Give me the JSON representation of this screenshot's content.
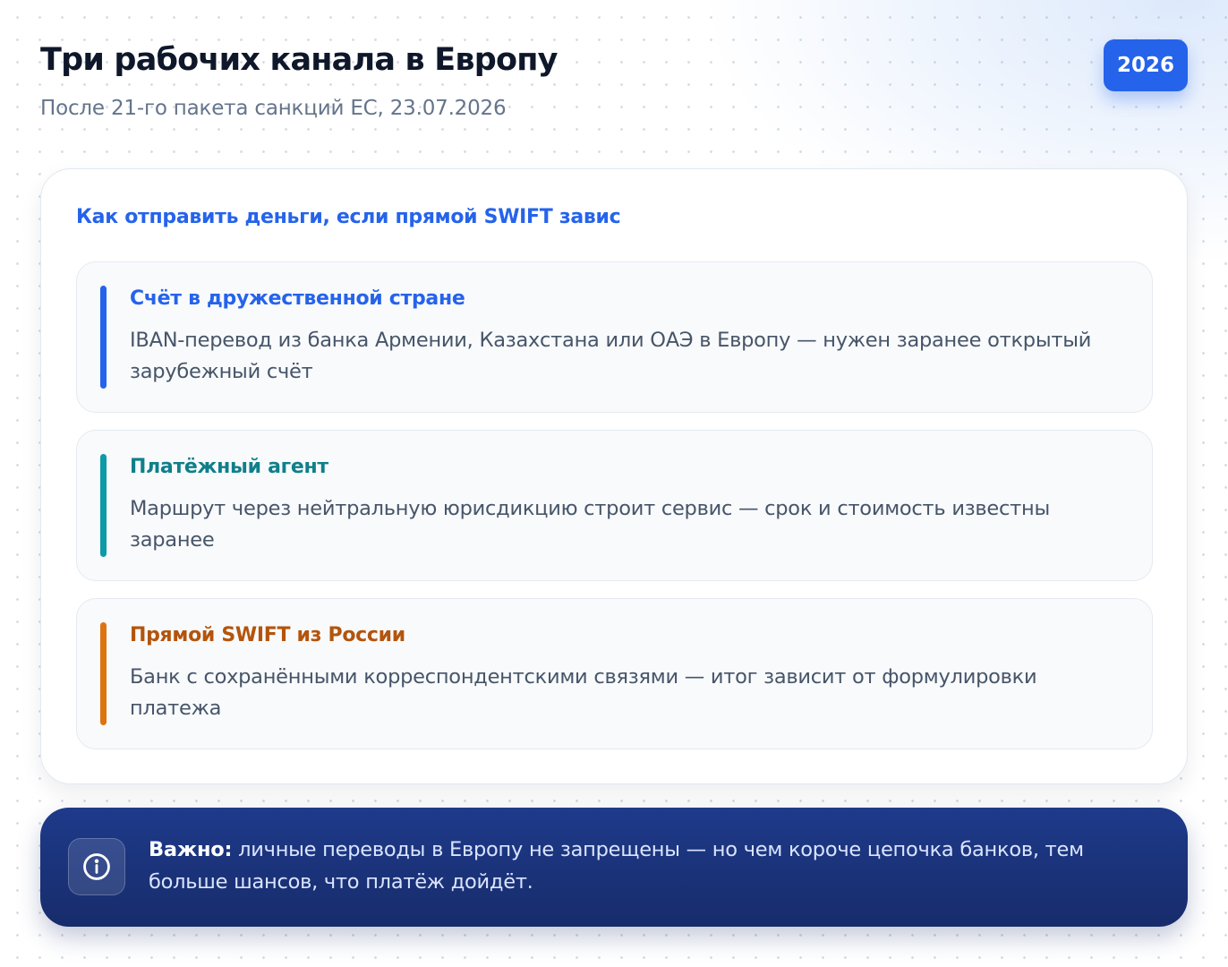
{
  "header": {
    "title": "Три рабочих канала в Европу",
    "subtitle": "После 21-го пакета санкций ЕС, 23.07.2026",
    "year_badge": "2026"
  },
  "card": {
    "heading": "Как отправить деньги, если прямой SWIFT завис",
    "channels": [
      {
        "title": "Счёт в дружественной стране",
        "description": "IBAN-перевод из банка Армении, Казахстана или ОАЭ в Европу — нужен заранее открытый зарубежный счёт",
        "accent_color": "#2563eb"
      },
      {
        "title": "Платёжный агент",
        "description": "Маршрут через нейтральную юрисдикцию строит сервис — срок и стоимость известны заранее",
        "accent_color": "#0e9aa7"
      },
      {
        "title": "Прямой SWIFT из России",
        "description": "Банк с сохранёнными корреспондентскими связями — итог зависит от формулировки платежа",
        "accent_color": "#dd7410"
      }
    ]
  },
  "notice": {
    "icon": "info-icon",
    "label": "Важно:",
    "text": "личные переводы в Европу не запрещены — но чем короче цепочка банков, тем больше шансов, что платёж дойдёт."
  },
  "colors": {
    "primary": "#2563eb",
    "notice_bg": "#1e3a8a"
  }
}
